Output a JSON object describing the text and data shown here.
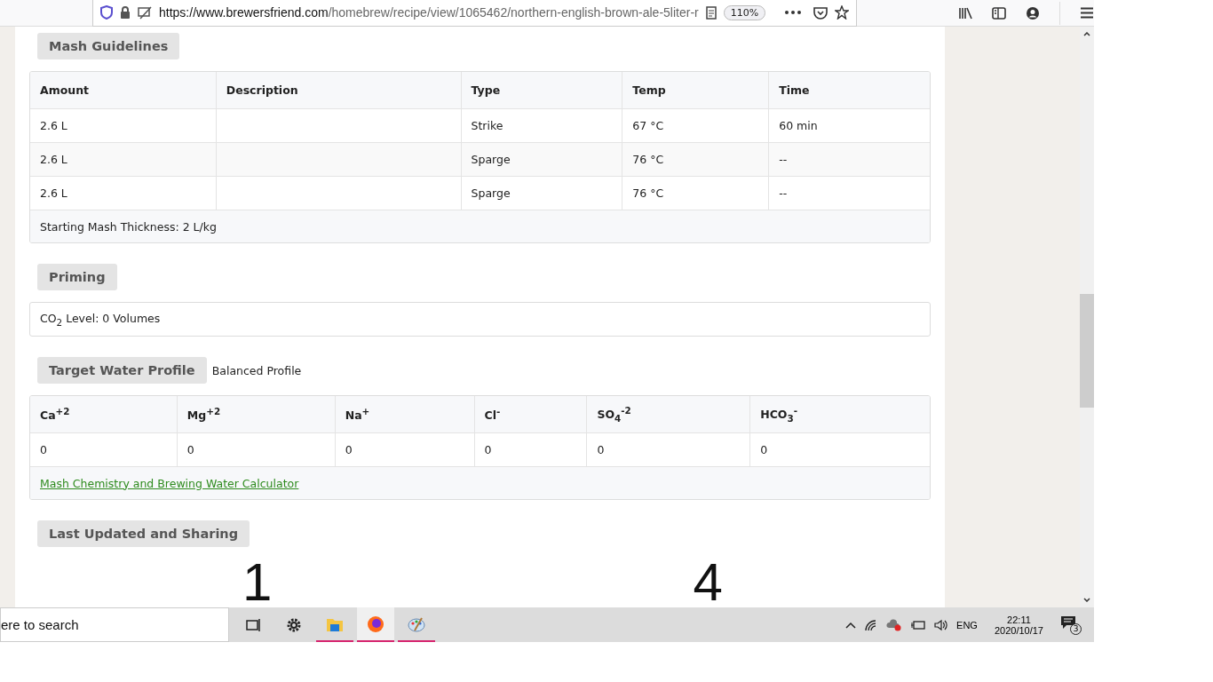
{
  "browser": {
    "url_host": "https://www.brewersfriend.com",
    "url_path": "/homebrew/recipe/view/1065462/northern-english-brown-ale-5liter-r",
    "zoom": "110%"
  },
  "mash": {
    "heading": "Mash Guidelines",
    "columns": [
      "Amount",
      "Description",
      "Type",
      "Temp",
      "Time"
    ],
    "rows": [
      [
        "2.6 L",
        "",
        "Strike",
        "67 °C",
        "60 min"
      ],
      [
        "2.6 L",
        "",
        "Sparge",
        "76 °C",
        "--"
      ],
      [
        "2.6 L",
        "",
        "Sparge",
        "76 °C",
        "--"
      ]
    ],
    "footer": "Starting Mash Thickness: 2 L/kg"
  },
  "priming": {
    "heading": "Priming",
    "text": "CO$_{2}$ Level: 0 Volumes"
  },
  "water": {
    "heading": "Target Water Profile",
    "profile": "Balanced Profile",
    "columns": [
      "Ca$^{+2}$",
      "Mg$^{+2}$",
      "Na$^{+}$",
      "Cl$^{-}$",
      "SO$_{4}$$^{-2}$",
      "HCO$_{3}$$^{-}$"
    ],
    "values": [
      "0",
      "0",
      "0",
      "0",
      "0",
      "0"
    ],
    "link": "Mash Chemistry and Brewing Water Calculator"
  },
  "sharing": {
    "heading": "Last Updated and Sharing",
    "stats": [
      "1",
      "4"
    ]
  },
  "taskbar": {
    "search": "ere to search",
    "apps": [
      {
        "kind": "taskview",
        "running": false,
        "selected": false
      },
      {
        "kind": "settings",
        "running": false,
        "selected": false
      },
      {
        "kind": "explorer",
        "running": true,
        "selected": false
      },
      {
        "kind": "firefox",
        "running": true,
        "selected": true
      },
      {
        "kind": "paint",
        "running": true,
        "selected": false
      }
    ],
    "language": "ENG",
    "time": "22:11",
    "date": "2020/10/17",
    "notifications": "3"
  }
}
